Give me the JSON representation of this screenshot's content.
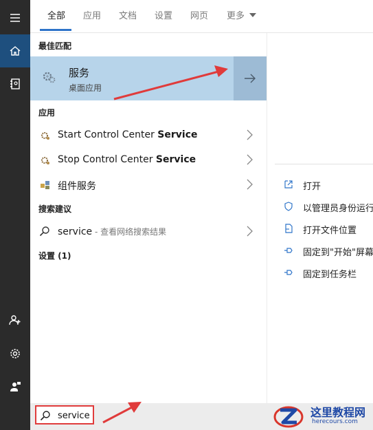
{
  "tabs": [
    {
      "label": "全部",
      "active": true
    },
    {
      "label": "应用",
      "active": false
    },
    {
      "label": "文档",
      "active": false
    },
    {
      "label": "设置",
      "active": false
    },
    {
      "label": "网页",
      "active": false
    },
    {
      "label": "更多",
      "active": false
    }
  ],
  "sections": {
    "best_match": "最佳匹配",
    "apps": "应用",
    "suggestions": "搜索建议",
    "settings": "设置 (1)"
  },
  "best_match": {
    "title": "服务",
    "subtitle": "桌面应用"
  },
  "apps": [
    {
      "prefix": "Start Control Center ",
      "bold": "Service",
      "icon": "service-gear-icon"
    },
    {
      "prefix": "Stop Control Center ",
      "bold": "Service",
      "icon": "service-gear-icon"
    },
    {
      "prefix": "组件服务",
      "bold": "",
      "icon": "component-services-icon"
    }
  ],
  "suggestion": {
    "term": "service",
    "hint": " - 查看网络搜索结果"
  },
  "actions": [
    {
      "label": "打开",
      "icon": "open-icon"
    },
    {
      "label": "以管理员身份运行",
      "icon": "shield-admin-icon"
    },
    {
      "label": "打开文件位置",
      "icon": "file-location-icon"
    },
    {
      "label": "固定到\"开始\"屏幕",
      "icon": "pin-icon"
    },
    {
      "label": "固定到任务栏",
      "icon": "pin-taskbar-icon"
    }
  ],
  "search": {
    "value": "service"
  },
  "watermark": {
    "title": "这里教程网",
    "url": "herecours.com"
  },
  "colors": {
    "highlight": "#b7d4ea",
    "accent": "#2e74c9",
    "annotation": "#e03b3b",
    "rail": "#2b2b2b"
  }
}
